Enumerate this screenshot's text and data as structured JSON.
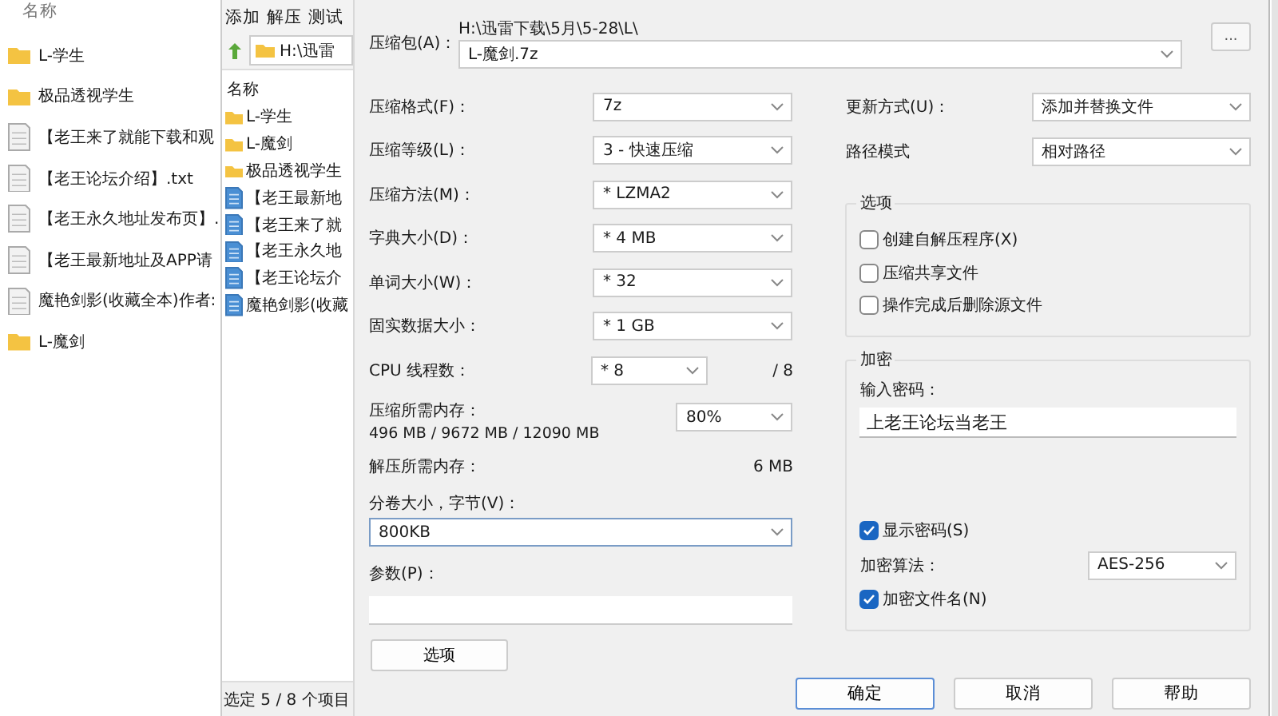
{
  "background_explorer": {
    "header": "名称",
    "items": [
      {
        "kind": "folder",
        "name": "L-学生"
      },
      {
        "kind": "folder",
        "name": "极品透视学生"
      },
      {
        "kind": "file",
        "name": "【老王来了就能下载和观"
      },
      {
        "kind": "file",
        "name": "【老王论坛介绍】.txt"
      },
      {
        "kind": "file",
        "name": "【老王永久地址发布页】."
      },
      {
        "kind": "file",
        "name": "【老王最新地址及APP请"
      },
      {
        "kind": "file",
        "name": "魔艳剑影(收藏全本)作者:"
      },
      {
        "kind": "folder",
        "name": "L-魔剑"
      }
    ]
  },
  "file_manager": {
    "menu": [
      "添加",
      "解压",
      "测试"
    ],
    "address": "H:\\迅雷",
    "header": "名称",
    "items": [
      {
        "kind": "folder",
        "name": "L-学生"
      },
      {
        "kind": "folder",
        "name": "L-魔剑"
      },
      {
        "kind": "folder",
        "name": "极品透视学生"
      },
      {
        "kind": "file",
        "name": "【老王最新地"
      },
      {
        "kind": "file",
        "name": "【老王来了就"
      },
      {
        "kind": "file",
        "name": "【老王永久地"
      },
      {
        "kind": "file",
        "name": "【老王论坛介"
      },
      {
        "kind": "file",
        "name": "魔艳剑影(收藏"
      }
    ],
    "status_bar": "选定 5 / 8 个项目"
  },
  "dialog": {
    "archive": {
      "label": "压缩包(A)：",
      "path": "H:\\迅雷下载\\5月\\5-28\\L\\",
      "value": "L-魔剑.7z",
      "browse": "..."
    },
    "settings": [
      {
        "label": "压缩格式(F)：",
        "value": "7z"
      },
      {
        "label": "压缩等级(L)：",
        "value": "3 - 快速压缩"
      },
      {
        "label": "压缩方法(M)：",
        "value": "* LZMA2"
      },
      {
        "label": "字典大小(D)：",
        "value": "* 4 MB"
      },
      {
        "label": "单词大小(W)：",
        "value": "* 32"
      },
      {
        "label": "固实数据大小：",
        "value": "* 1 GB"
      }
    ],
    "cpu": {
      "label": "CPU 线程数：",
      "value": "* 8",
      "max": "/ 8"
    },
    "memory": {
      "label": "压缩所需内存：",
      "detail": "496 MB / 9672 MB / 12090 MB",
      "value": "80%"
    },
    "decompress": {
      "label": "解压所需内存：",
      "value": "6 MB"
    },
    "volume": {
      "label": "分卷大小，字节(V)：",
      "value": "800KB"
    },
    "params": {
      "label": "参数(P)："
    },
    "options_button": "选项",
    "update": {
      "label": "更新方式(U)：",
      "value": "添加并替换文件"
    },
    "path_mode": {
      "label": "路径模式",
      "value": "相对路径"
    },
    "options_group": {
      "title": "选项",
      "checkboxes": [
        {
          "label": "创建自解压程序(X)",
          "checked": false
        },
        {
          "label": "压缩共享文件",
          "checked": false
        },
        {
          "label": "操作完成后删除源文件",
          "checked": false
        }
      ]
    },
    "encryption": {
      "title": "加密",
      "password_label": "输入密码：",
      "password": "上老王论坛当老王",
      "show_password": {
        "label": "显示密码(S)",
        "checked": true
      },
      "method_label": "加密算法：",
      "method": "AES-256",
      "encrypt_names": {
        "label": "加密文件名(N)",
        "checked": true
      }
    },
    "buttons": [
      "确定",
      "取消",
      "帮助"
    ]
  }
}
